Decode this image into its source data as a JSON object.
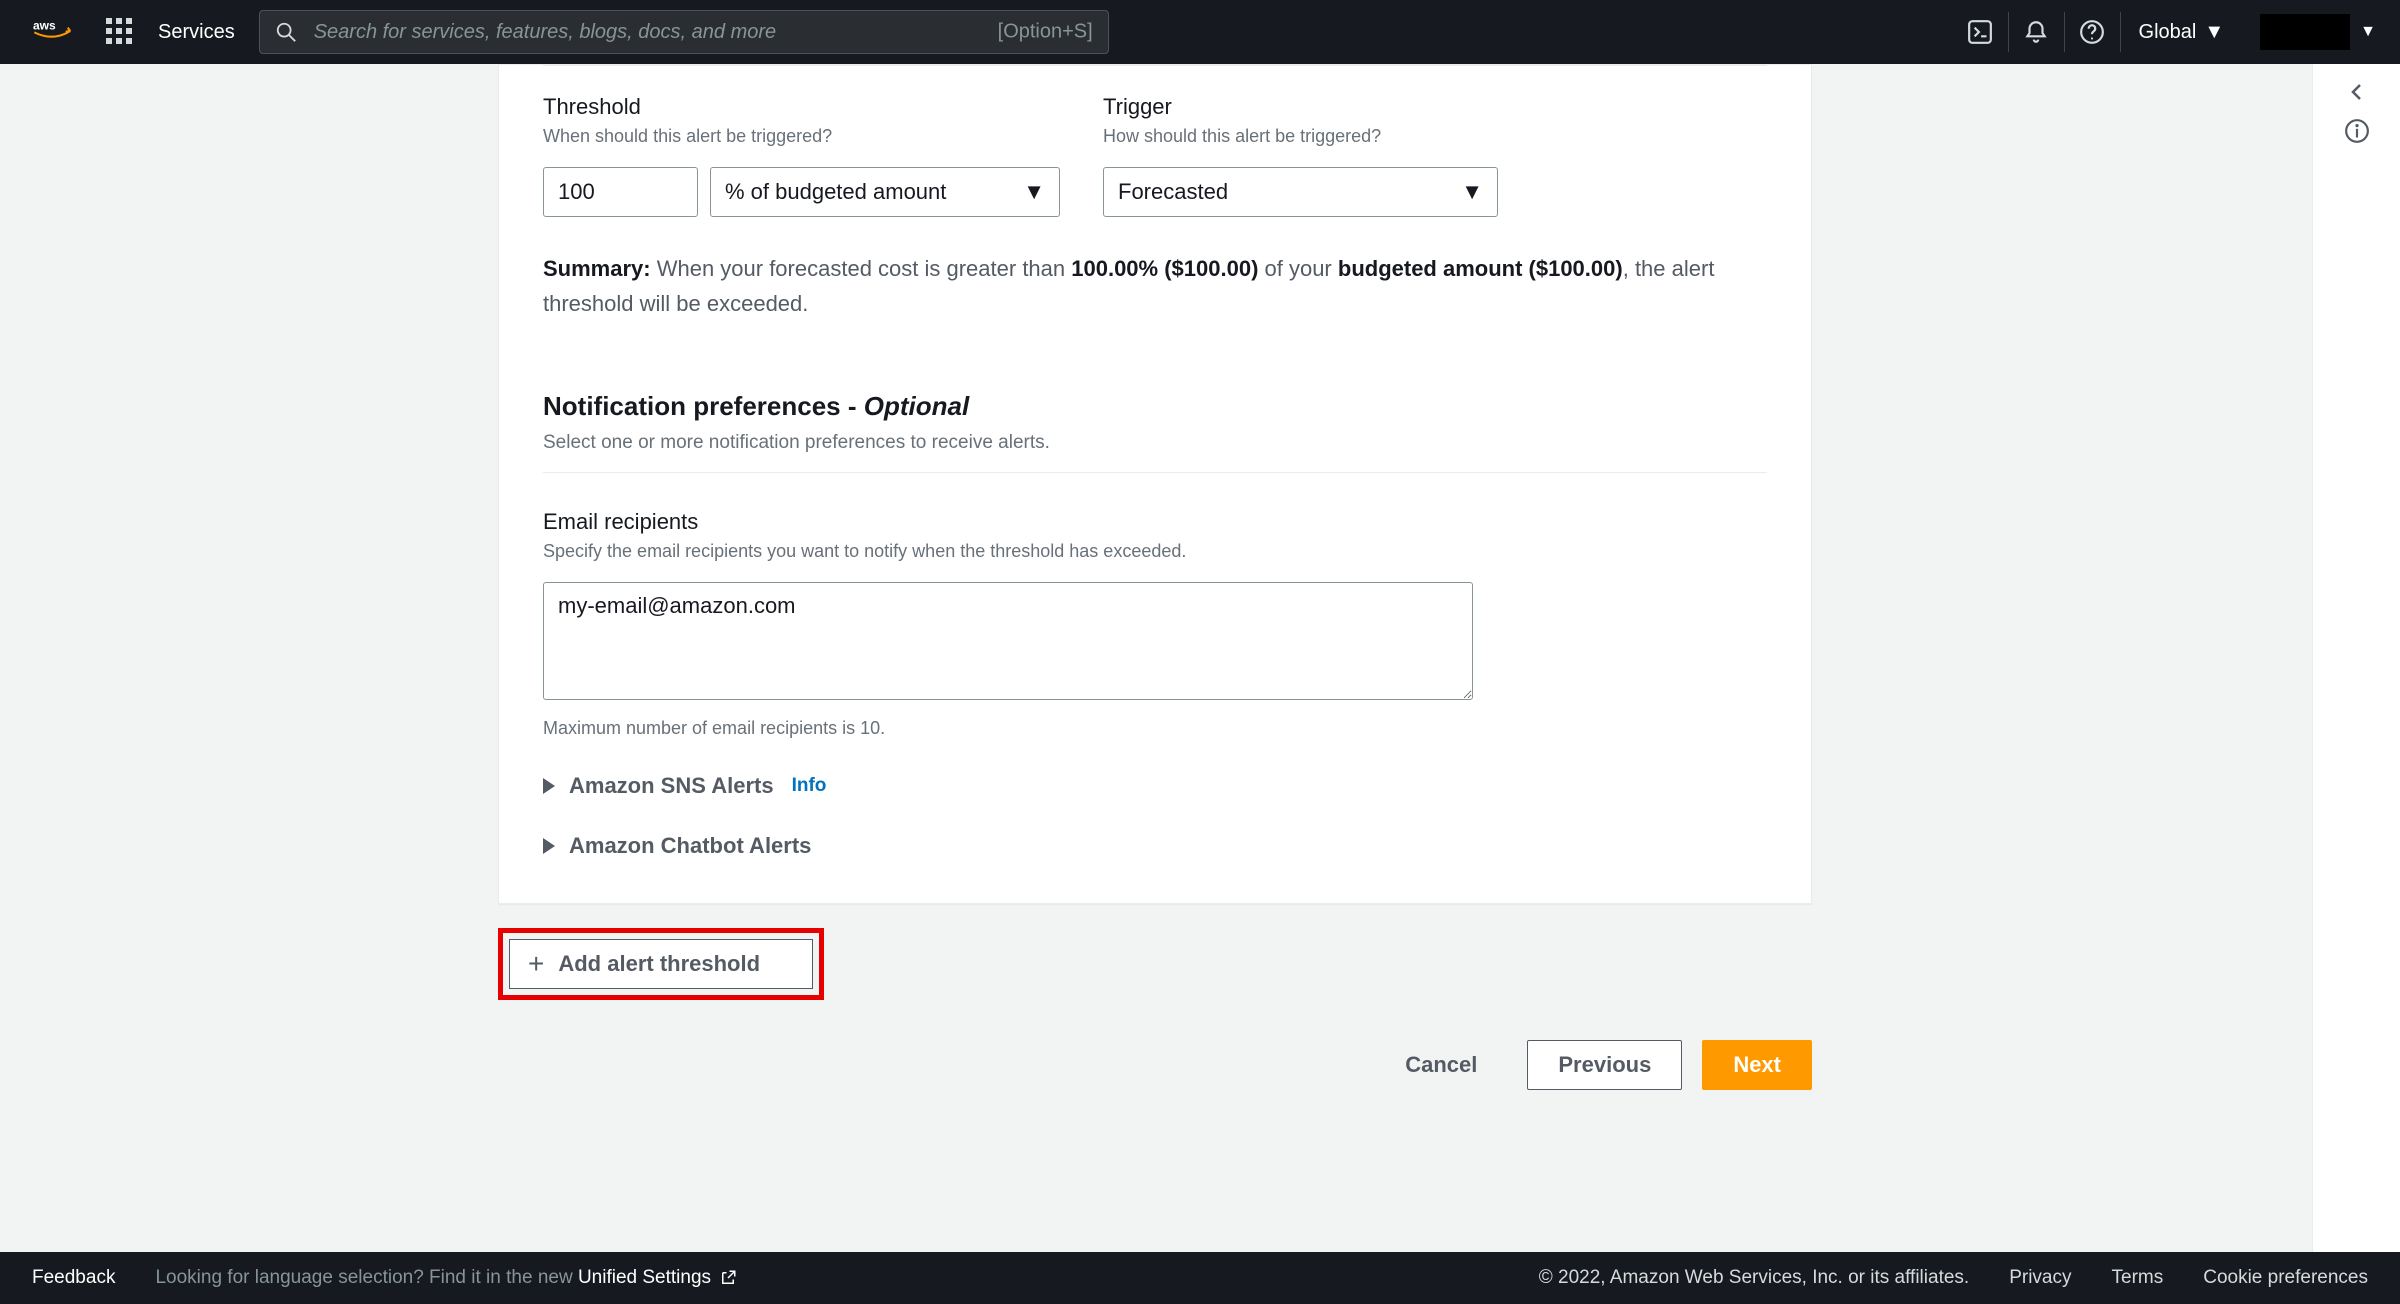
{
  "nav": {
    "logo": "aws",
    "services": "Services",
    "search_placeholder": "Search for services, features, blogs, docs, and more",
    "shortcut": "[Option+S]",
    "region": "Global"
  },
  "threshold": {
    "label": "Threshold",
    "desc": "When should this alert be triggered?",
    "value": "100",
    "unit": "% of budgeted amount"
  },
  "trigger": {
    "label": "Trigger",
    "desc": "How should this alert be triggered?",
    "value": "Forecasted"
  },
  "summary": {
    "prefix": "Summary:",
    "t1": " When your forecasted cost is greater than ",
    "pct": "100.00% ($100.00)",
    "t2": " of your ",
    "budget": "budgeted amount ($100.00)",
    "t3": ", the alert threshold will be exceeded."
  },
  "notif": {
    "title": "Notification preferences - ",
    "optional": "Optional",
    "desc": "Select one or more notification preferences to receive alerts."
  },
  "email": {
    "label": "Email recipients",
    "desc": "Specify the email recipients you want to notify when the threshold has exceeded.",
    "value": "my-email@amazon.com",
    "hint": "Maximum number of email recipients is 10."
  },
  "expanders": {
    "sns": "Amazon SNS Alerts",
    "sns_info": "Info",
    "chatbot": "Amazon Chatbot Alerts"
  },
  "add_btn": "Add alert threshold",
  "buttons": {
    "cancel": "Cancel",
    "previous": "Previous",
    "next": "Next"
  },
  "footer": {
    "feedback": "Feedback",
    "lang1": "Looking for language selection? Find it in the new ",
    "lang2": "Unified Settings",
    "copyright": "© 2022, Amazon Web Services, Inc. or its affiliates.",
    "privacy": "Privacy",
    "terms": "Terms",
    "cookie": "Cookie preferences"
  }
}
